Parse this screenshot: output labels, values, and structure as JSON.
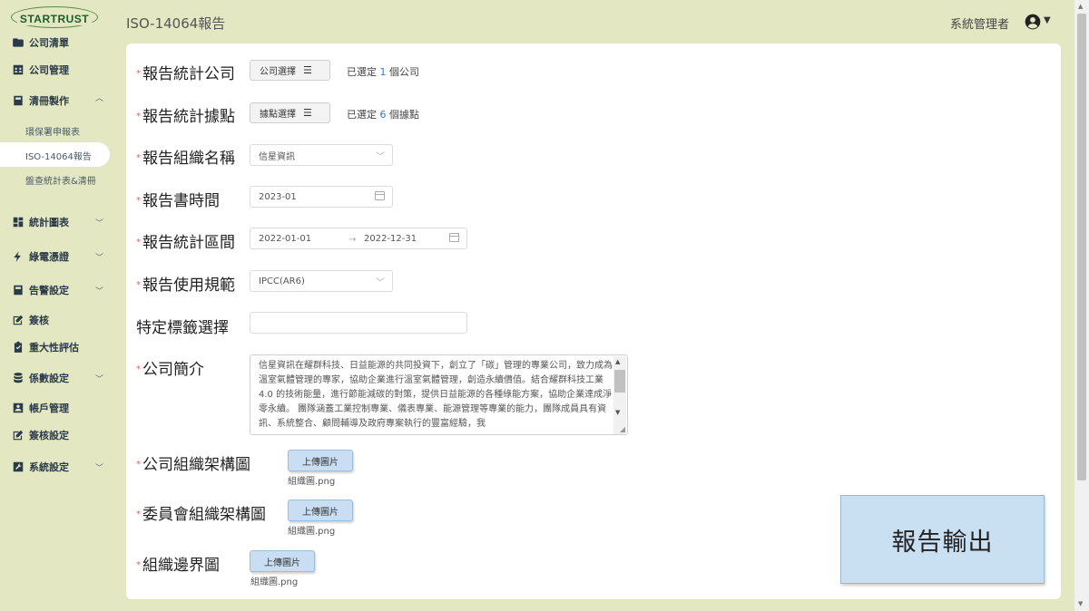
{
  "brand": {
    "logo_text": "STARTRUST"
  },
  "sidebar": {
    "items": [
      {
        "label": "公司清單",
        "icon": "folder-icon"
      },
      {
        "label": "公司管理",
        "icon": "contacts-icon"
      },
      {
        "label": "清冊製作",
        "icon": "book-icon",
        "expanded": true
      },
      {
        "label": "統計圖表",
        "icon": "dashboard-icon"
      },
      {
        "label": "綠電憑證",
        "icon": "lightning-icon"
      },
      {
        "label": "告警設定",
        "icon": "book-icon"
      },
      {
        "label": "簽核",
        "icon": "sign-icon"
      },
      {
        "label": "重大性評估",
        "icon": "clipboard-check-icon"
      },
      {
        "label": "係數設定",
        "icon": "database-icon"
      },
      {
        "label": "帳戶管理",
        "icon": "account-box-icon"
      },
      {
        "label": "簽核設定",
        "icon": "sign-icon"
      },
      {
        "label": "系統設定",
        "icon": "wrench-icon"
      }
    ],
    "sub_items": [
      "環保署申報表",
      "ISO-14064報告",
      "盤查統計表&清冊"
    ],
    "active_sub": "ISO-14064報告"
  },
  "header": {
    "title": "ISO-14064報告",
    "user": "系統管理者"
  },
  "form": {
    "company": {
      "label": "報告統計公司",
      "button": "公司選擇",
      "info_prefix": "已選定",
      "count": "1",
      "info_suffix": "個公司"
    },
    "site": {
      "label": "報告統計據點",
      "button": "據點選擇",
      "info_prefix": "已選定",
      "count": "6",
      "info_suffix": "個據點"
    },
    "org_name": {
      "label": "報告組織名稱",
      "value": "信星資訊"
    },
    "report_time": {
      "label": "報告書時間",
      "value": "2023-01"
    },
    "stat_range": {
      "label": "報告統計區間",
      "start": "2022-01-01",
      "end": "2022-12-31"
    },
    "standard": {
      "label": "報告使用規範",
      "value": "IPCC(AR6)"
    },
    "tag": {
      "label": "特定標籤選擇",
      "value": ""
    },
    "intro": {
      "label": "公司簡介",
      "value": "信星資訊在耀群科技、日益能源的共同投資下，創立了「碳」管理的專業公司，致力成為溫室氣體管理的專家，協助企業進行溫室氣體管理，創造永續價值。結合耀群科技工業4.0 的技術能量，進行節能減碳的對策，提供日益能源的各種綠能方案，協助企業達成淨零永續。 團隊涵蓋工業控制專業、儀表專業、能源管理等專業的能力，團隊成員具有資訊、系統整合、顧問輔導及政府專案執行的豐富經驗，我"
    },
    "org_chart": {
      "label": "公司組織架構圖",
      "button": "上傳圖片",
      "file": "組織圖.png"
    },
    "committee_chart": {
      "label": "委員會組織架構圖",
      "button": "上傳圖片",
      "file": "組織圖.png"
    },
    "boundary_chart": {
      "label": "組織邊界圖",
      "button": "上傳圖片",
      "file": "組織圖.png"
    }
  },
  "export_button": "報告輸出",
  "colors": {
    "background": "#e3e8c2",
    "card": "#ffffff",
    "accent_button": "#c9dff2",
    "required": "#e06666",
    "count_highlight": "#3a78c8"
  }
}
